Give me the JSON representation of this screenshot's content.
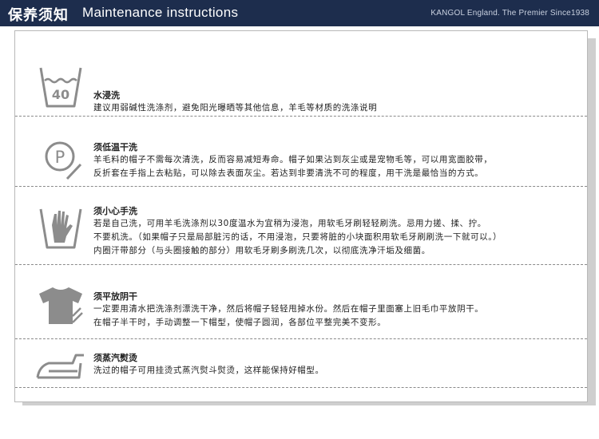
{
  "header": {
    "title_cn": "保养须知",
    "title_en": "Maintenance instructions",
    "brand": "KANGOL England.   The Premier  Since1938"
  },
  "sections": [
    {
      "icon": "wash-40-icon",
      "icon_text": "40",
      "heading": "水浸洗",
      "lines": [
        "建议用弱碱性洗涤剂，避免阳光曝晒等其他信息，羊毛等材质的洗涤说明"
      ]
    },
    {
      "icon": "dry-clean-p-icon",
      "icon_text": "P",
      "heading": "须低温干洗",
      "lines": [
        "羊毛料的帽子不需每次清洗，反而容易减短寿命。帽子如果沾到灰尘或是宠物毛等，可以用宽面胶带，",
        "反折套在手指上去粘贴，可以除去表面灰尘。若达到非要清洗不可的程度，用干洗是最恰当的方式。"
      ]
    },
    {
      "icon": "hand-wash-icon",
      "heading": "须小心手洗",
      "lines": [
        "若是自己洗，可用羊毛洗涤剂以30度温水为宜稍为浸泡，用软毛牙刷轻轻刷洗。忌用力搓、揉、拧。",
        "不要机洗。（如果帽子只是局部脏污的话，不用浸泡，只要将脏的小块面积用软毛牙刷刷洗一下就可以。）",
        "内圈汗带部分（与头圈接触的部分）用软毛牙刷多刷洗几次，以彻底洗净汗垢及细菌。"
      ]
    },
    {
      "icon": "flat-dry-shade-icon",
      "heading": "须平放阴干",
      "lines": [
        "一定要用清水把洗涤剂漂洗干净，然后将帽子轻轻甩掉水份。然后在帽子里面塞上旧毛巾平放阴干。",
        "在帽子半干时，手动调整一下帽型，使帽子圆润，各部位平整完美不变形。"
      ]
    },
    {
      "icon": "steam-iron-icon",
      "heading": "须蒸汽熨烫",
      "lines": [
        "洗过的帽子可用挂烫式蒸汽熨斗熨烫，这样能保持好帽型。"
      ]
    }
  ],
  "colors": {
    "header_bg": "#1d2d4d",
    "icon_gray": "#8c8c8c",
    "text": "#222222"
  }
}
